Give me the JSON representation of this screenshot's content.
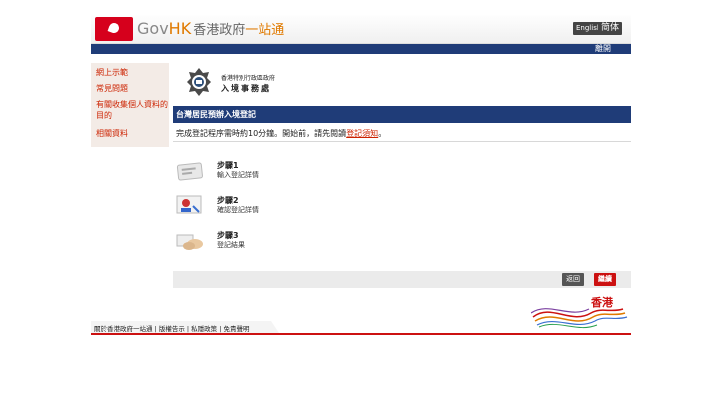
{
  "header": {
    "brand_gov": "Gov",
    "brand_hk": "HK",
    "brand_zh": "香港政府",
    "brand_zh2": "一站通",
    "lang_en": "English",
    "lang_sc": "简体",
    "nav_about": "離開"
  },
  "sidebar": {
    "items": [
      {
        "label": "網上示範"
      },
      {
        "label": "常見問題"
      },
      {
        "label": "有關收集個人資料的目的"
      },
      {
        "label": "相關資料"
      }
    ]
  },
  "department": {
    "name_line1": "香港特別行政區政府",
    "name_line2": "入境事務處"
  },
  "main": {
    "title": "台灣居民預辦入境登記",
    "intro_text": "完成登記程序需時約10分鐘。開始前，請先閱讀",
    "intro_link": "登記須知",
    "intro_end": "。",
    "steps": [
      {
        "title": "步驟1",
        "desc": "輸入登記詳情"
      },
      {
        "title": "步驟2",
        "desc": "確認登記詳情"
      },
      {
        "title": "步驟3",
        "desc": "登記結果"
      }
    ],
    "back_label": "返回",
    "next_label": "繼續"
  },
  "hk_logo_text": "香港",
  "footer": {
    "links": "關於香港政府一站通 | 版權告示 | 私隱政策 | 免責聲明"
  },
  "colors": {
    "navy": "#1f3c78",
    "accent_red": "#cc1111",
    "brand_orange": "#e07a00"
  }
}
